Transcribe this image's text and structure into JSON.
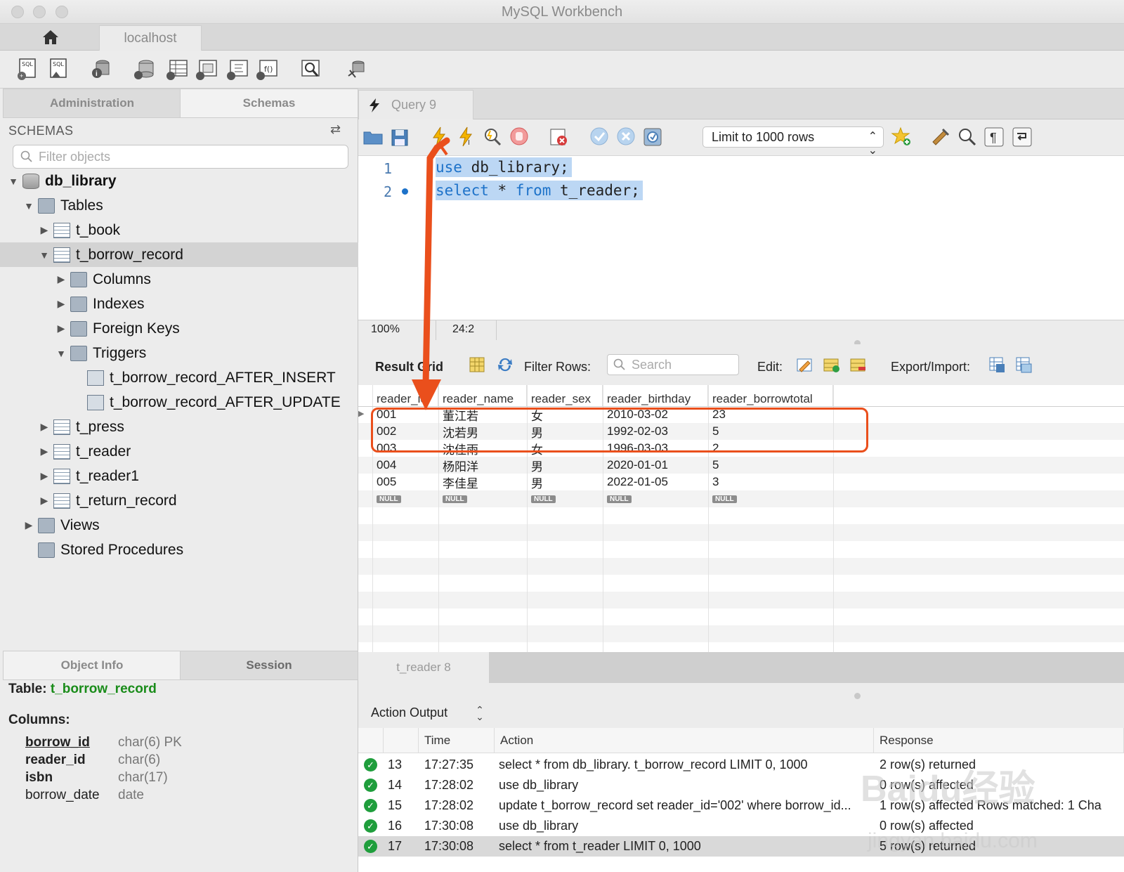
{
  "window": {
    "title": "MySQL Workbench"
  },
  "tabs": {
    "connection": "localhost"
  },
  "left_tabs": [
    "Administration",
    "Schemas"
  ],
  "schemas_header": "SCHEMAS",
  "filter_placeholder": "Filter objects",
  "tree": [
    {
      "label": "db_library",
      "level": 0,
      "arrow": "▼",
      "icon": "database-icon",
      "bold": true
    },
    {
      "label": "Tables",
      "level": 1,
      "arrow": "▼",
      "icon": "folder-icon"
    },
    {
      "label": "t_book",
      "level": 2,
      "arrow": "▶",
      "icon": "table-icon"
    },
    {
      "label": "t_borrow_record",
      "level": 2,
      "arrow": "▼",
      "icon": "table-icon",
      "selected": true
    },
    {
      "label": "Columns",
      "level": 3,
      "arrow": "▶",
      "icon": "folder-icon"
    },
    {
      "label": "Indexes",
      "level": 3,
      "arrow": "▶",
      "icon": "folder-icon"
    },
    {
      "label": "Foreign Keys",
      "level": 3,
      "arrow": "▶",
      "icon": "folder-icon"
    },
    {
      "label": "Triggers",
      "level": 3,
      "arrow": "▼",
      "icon": "folder-icon"
    },
    {
      "label": "t_borrow_record_AFTER_INSERT",
      "level": 4,
      "arrow": "",
      "icon": "trigger-icon"
    },
    {
      "label": "t_borrow_record_AFTER_UPDATE",
      "level": 4,
      "arrow": "",
      "icon": "trigger-icon"
    },
    {
      "label": "t_press",
      "level": 2,
      "arrow": "▶",
      "icon": "table-icon"
    },
    {
      "label": "t_reader",
      "level": 2,
      "arrow": "▶",
      "icon": "table-icon"
    },
    {
      "label": "t_reader1",
      "level": 2,
      "arrow": "▶",
      "icon": "table-icon"
    },
    {
      "label": "t_return_record",
      "level": 2,
      "arrow": "▶",
      "icon": "table-icon"
    },
    {
      "label": "Views",
      "level": 1,
      "arrow": "▶",
      "icon": "folder-icon"
    },
    {
      "label": "Stored Procedures",
      "level": 1,
      "arrow": "",
      "icon": "folder-icon"
    }
  ],
  "info_tabs": [
    "Object Info",
    "Session"
  ],
  "object_info": {
    "table_label": "Table:",
    "table_name": "t_borrow_record",
    "columns_label": "Columns:",
    "columns": [
      {
        "name": "borrow_id",
        "type": "char(6) PK",
        "underline": true
      },
      {
        "name": "reader_id",
        "type": "char(6)"
      },
      {
        "name": "isbn",
        "type": "char(17)"
      },
      {
        "name": "borrow_date",
        "type": "date",
        "normal": true
      }
    ]
  },
  "query_tab": "Query 9",
  "limit_select": "Limit to 1000 rows",
  "editor": {
    "lines": [
      {
        "num": "1",
        "kw1": "use",
        "rest": " db_library;"
      },
      {
        "num": "2",
        "kw1": "select",
        "mid": " * ",
        "kw2": "from",
        "rest": " t_reader;"
      }
    ]
  },
  "status": {
    "zoom": "100%",
    "position": "24:2"
  },
  "result_bar": {
    "label": "Result Grid",
    "filter_label": "Filter Rows:",
    "search_placeholder": "Search",
    "edit_label": "Edit:",
    "export_label": "Export/Import:"
  },
  "grid": {
    "columns": [
      "reader_id",
      "reader_name",
      "reader_sex",
      "reader_birthday",
      "reader_borrowtotal"
    ],
    "rows": [
      [
        "001",
        "董江若",
        "女",
        "2010-03-02",
        "23"
      ],
      [
        "002",
        "沈若男",
        "男",
        "1992-02-03",
        "5"
      ],
      [
        "003",
        "沈佳雨",
        "女",
        "1996-03-03",
        "2"
      ],
      [
        "004",
        "杨阳洋",
        "男",
        "2020-01-01",
        "5"
      ],
      [
        "005",
        "李佳星",
        "男",
        "2022-01-05",
        "3"
      ]
    ],
    "null_label": "NULL"
  },
  "result_tab": "t_reader 8",
  "output": {
    "selector": "Action Output",
    "headers": [
      "Time",
      "Action",
      "Response"
    ],
    "rows": [
      {
        "num": "13",
        "time": "17:27:35",
        "action": "select * from db_library. t_borrow_record LIMIT 0, 1000",
        "response": "2 row(s) returned"
      },
      {
        "num": "14",
        "time": "17:28:02",
        "action": "use db_library",
        "response": "0 row(s) affected"
      },
      {
        "num": "15",
        "time": "17:28:02",
        "action": "update  t_borrow_record set reader_id='002' where borrow_id...",
        "response": "1 row(s) affected Rows matched: 1  Cha"
      },
      {
        "num": "16",
        "time": "17:30:08",
        "action": "use db_library",
        "response": "0 row(s) affected"
      },
      {
        "num": "17",
        "time": "17:30:08",
        "action": "select * from t_reader LIMIT 0, 1000",
        "response": "5 row(s) returned",
        "selected": true
      }
    ]
  },
  "watermark": {
    "line1": "Baidu经验",
    "line2": "jingyan.baidu.com"
  },
  "colors": {
    "accent": "#1d72c9",
    "highlight": "#bcd7f4",
    "annotation": "#ea4f1c",
    "ok": "#1f9e3c",
    "table_name": "#1a8c1a"
  }
}
